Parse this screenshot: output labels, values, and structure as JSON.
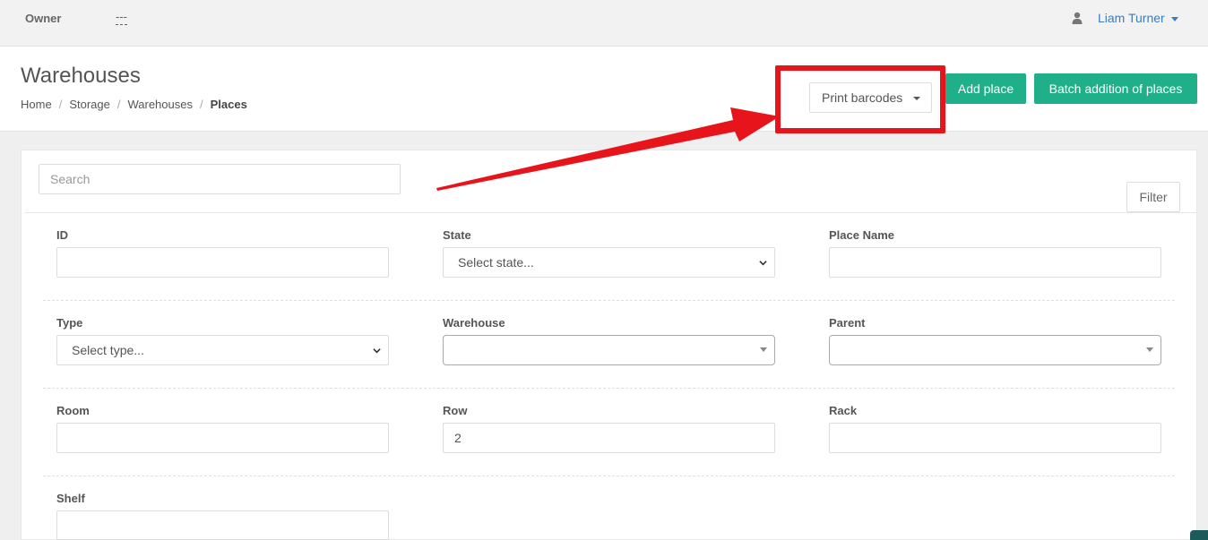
{
  "topbar": {
    "owner_label": "Owner",
    "owner_value": "---",
    "user_name": "Liam Turner"
  },
  "header": {
    "title": "Warehouses",
    "breadcrumb": [
      "Home",
      "Storage",
      "Warehouses",
      "Places"
    ],
    "print_barcodes_label": "Print barcodes",
    "add_place_label": "Add place",
    "batch_label": "Batch addition of places"
  },
  "search": {
    "placeholder": "Search"
  },
  "filter_button": "Filter",
  "fields": {
    "id": {
      "label": "ID",
      "value": ""
    },
    "state": {
      "label": "State",
      "placeholder": "Select state..."
    },
    "place_name": {
      "label": "Place Name",
      "value": ""
    },
    "type": {
      "label": "Type",
      "placeholder": "Select type..."
    },
    "warehouse": {
      "label": "Warehouse",
      "value": ""
    },
    "parent": {
      "label": "Parent",
      "value": ""
    },
    "room": {
      "label": "Room",
      "value": ""
    },
    "row": {
      "label": "Row",
      "value": "2"
    },
    "rack": {
      "label": "Rack",
      "value": ""
    },
    "shelf": {
      "label": "Shelf",
      "value": ""
    }
  },
  "colors": {
    "accent": "#1fb08a",
    "highlight": "#e8141b",
    "link": "#3a7dc0"
  }
}
